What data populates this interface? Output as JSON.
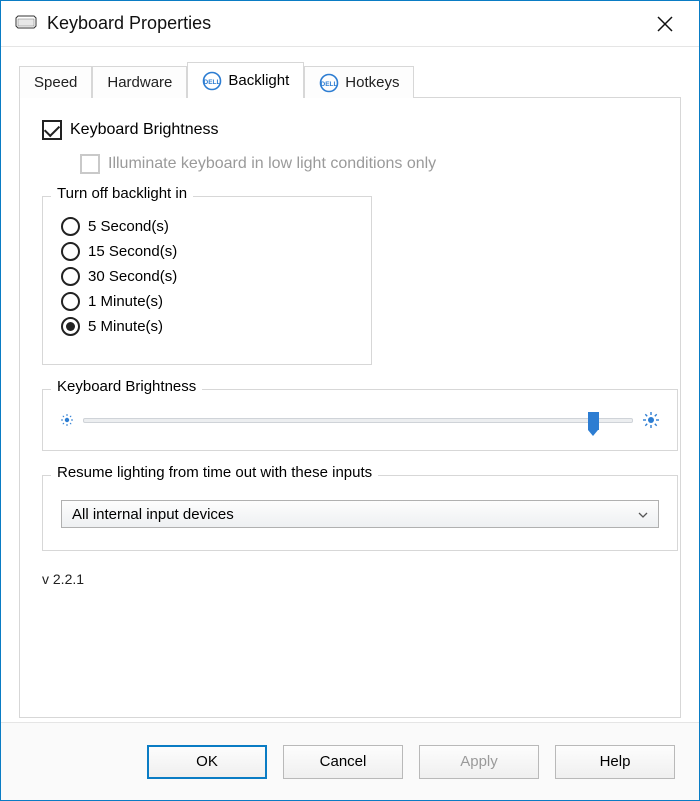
{
  "window": {
    "title": "Keyboard Properties"
  },
  "tabs": {
    "speed": "Speed",
    "hardware": "Hardware",
    "backlight": "Backlight",
    "hotkeys": "Hotkeys"
  },
  "backlight_panel": {
    "kb_brightness_chk": "Keyboard Brightness",
    "lowlight_chk": "Illuminate keyboard in low light conditions only",
    "turnoff_group": {
      "legend": "Turn off backlight in",
      "options": {
        "o0": "5 Second(s)",
        "o1": "15 Second(s)",
        "o2": "30 Second(s)",
        "o3": "1 Minute(s)",
        "o4": "5 Minute(s)"
      },
      "selected_index": 4
    },
    "brightness_group": {
      "legend": "Keyboard Brightness",
      "percent": 92
    },
    "resume_group": {
      "legend": "Resume lighting from time out with these inputs",
      "selected": "All internal input devices"
    },
    "version": "v 2.2.1"
  },
  "footer": {
    "ok": "OK",
    "cancel": "Cancel",
    "apply": "Apply",
    "help": "Help"
  },
  "colors": {
    "accent": "#0a7cc4",
    "slider": "#2d7dd2"
  }
}
